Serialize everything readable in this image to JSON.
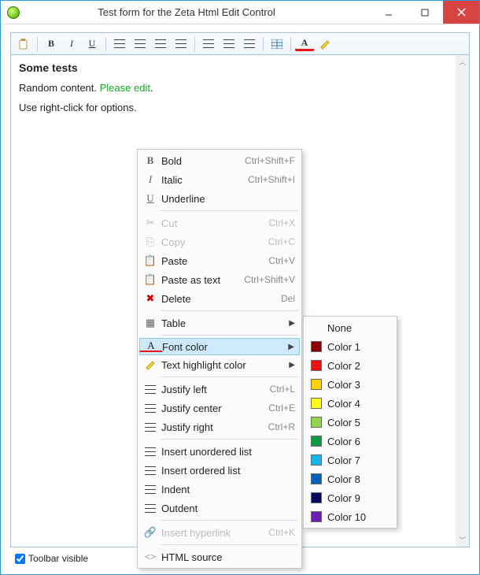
{
  "window": {
    "title": "Test form for the Zeta Html Edit Control"
  },
  "toolbar": {
    "paste": "Paste",
    "bold": "B",
    "italic": "I",
    "underline": "U"
  },
  "document": {
    "heading": "Some tests",
    "line1_a": "Random content. ",
    "line1_b": "Please edit",
    "line1_c": ".",
    "line2": "Use right-click for options."
  },
  "ctx": {
    "bold": "Bold",
    "bold_sc": "Ctrl+Shift+F",
    "italic": "Italic",
    "italic_sc": "Ctrl+Shift+I",
    "underline": "Underline",
    "cut": "Cut",
    "cut_sc": "Ctrl+X",
    "copy": "Copy",
    "copy_sc": "Ctrl+C",
    "paste": "Paste",
    "paste_sc": "Ctrl+V",
    "paste_text": "Paste as text",
    "paste_text_sc": "Ctrl+Shift+V",
    "delete": "Delete",
    "delete_sc": "Del",
    "table": "Table",
    "font_color": "Font color",
    "highlight": "Text highlight color",
    "justify_left": "Justify left",
    "justify_left_sc": "Ctrl+L",
    "justify_center": "Justify center",
    "justify_center_sc": "Ctrl+E",
    "justify_right": "Justify right",
    "justify_right_sc": "Ctrl+R",
    "ul": "Insert unordered list",
    "ol": "Insert ordered list",
    "indent": "Indent",
    "outdent": "Outdent",
    "link": "Insert hyperlink",
    "link_sc": "Ctrl+K",
    "html": "HTML source"
  },
  "colors": {
    "items": [
      {
        "label": "None",
        "hex": ""
      },
      {
        "label": "Color 1",
        "hex": "#8b0000"
      },
      {
        "label": "Color 2",
        "hex": "#e81313"
      },
      {
        "label": "Color 3",
        "hex": "#fcd307"
      },
      {
        "label": "Color 4",
        "hex": "#ffff1a"
      },
      {
        "label": "Color 5",
        "hex": "#93d350"
      },
      {
        "label": "Color 6",
        "hex": "#0f9a47"
      },
      {
        "label": "Color 7",
        "hex": "#15b7ea"
      },
      {
        "label": "Color 8",
        "hex": "#0663b3"
      },
      {
        "label": "Color 9",
        "hex": "#0a0a62"
      },
      {
        "label": "Color 10",
        "hex": "#6c1eb0"
      }
    ]
  },
  "footer": {
    "toolbar_visible": "Toolbar visible",
    "checked": true
  }
}
